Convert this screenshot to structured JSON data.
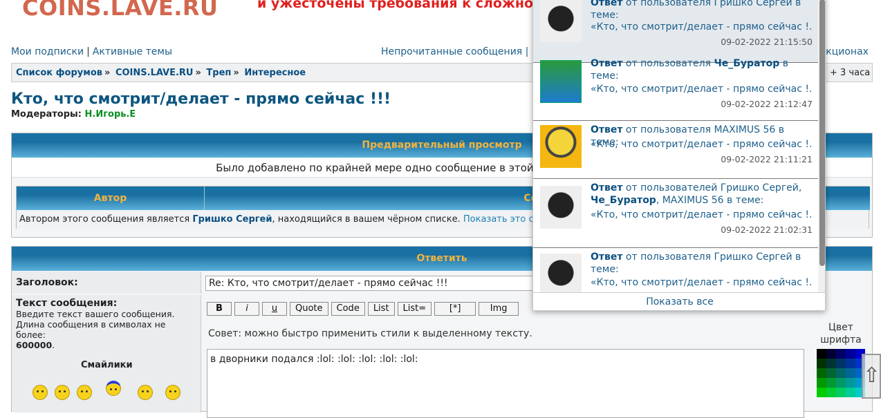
{
  "header": {
    "logo": "COINS.LAVE.RU",
    "banner": "и ужесточены требования к сложнос"
  },
  "nav": {
    "subscriptions": "Мои подписки",
    "sep": "|",
    "active_topics": "Активные темы",
    "unread": "Непрочитанные сообщения",
    "unread_sep": "| Н",
    "auctions": "укционах"
  },
  "breadcrumb": {
    "items": [
      "Список форумов",
      "COINS.LAVE.RU",
      "Треп",
      "Интересное"
    ],
    "sep": "»",
    "timezone": "+ 3 часа"
  },
  "topic": {
    "title": "Кто, что смотрит/делает - прямо сейчас !!!",
    "moderators_label": "Модераторы:",
    "moderator": "Н.Игорь.Е"
  },
  "preview": {
    "heading": "Предварительный просмотр",
    "notice": "Было добавлено по крайней мере одно сообщение в этой теме. Возможно, вы зах",
    "author_col": "Автор",
    "message_col": "Сооб",
    "blocked_prefix": "Автором этого сообщения является",
    "blocked_user": "Гришко Сергей",
    "blocked_suffix": ", находящийся в вашем чёрном списке.",
    "show_link": "Показать это сообще"
  },
  "reply": {
    "heading": "Ответить",
    "subject_label": "Заголовок:",
    "subject_value": "Re: Кто, что смотрит/делает - прямо сейчас !!!",
    "text_label": "Текст сообщения:",
    "hint1": "Введите текст вашего сообщения.",
    "hint2": "Длина сообщения в символах не более:",
    "max_len": "600000",
    "smilies_label": "Смайлики",
    "toolbar": {
      "bold": "B",
      "italic": "i",
      "underline": "u",
      "quote": "Quote",
      "code": "Code",
      "list": "List",
      "list_eq": "List=",
      "star": "[*]",
      "img": "Img"
    },
    "tip": "Совет: можно быстро применить стили к выделенному тексту.",
    "message": "в дворники подался  :lol:  :lol:  :lol:  :lol:  :lol:",
    "font_color_label": "Цвет шрифта"
  },
  "notifications": {
    "items": [
      {
        "prefix": "Ответ",
        "text": " от пользователя Гришко Сергей в теме:",
        "quote": "«Кто, что смотрит/делает - прямо сейчас !...",
        "time": "09-02-2022 21:15:50"
      },
      {
        "prefix": "Ответ",
        "text_a": " от пользователя ",
        "user": "Че_Буратор",
        "text_b": " в теме:",
        "quote": "«Кто, что смотрит/делает - прямо сейчас !...",
        "time": "09-02-2022 21:12:47"
      },
      {
        "prefix": "Ответ",
        "text": " от пользователя MAXIMUS 56 в теме:",
        "quote": "«Кто, что смотрит/делает - прямо сейчас !...",
        "time": "09-02-2022 21:11:21"
      },
      {
        "prefix": "Ответ",
        "text_a": " от пользователей Гришко Сергей,",
        "user": "Че_Буратор",
        "text_b": ", MAXIMUS 56 в теме:",
        "quote": "«Кто, что смотрит/делает - прямо сейчас !...",
        "time": "09-02-2022 21:02:31"
      },
      {
        "prefix": "Ответ",
        "text": " от пользователя Гришко Сергей в теме:",
        "quote": "«Кто, что смотрит/делает - прямо сейчас !..."
      }
    ],
    "show_all": "Показать все"
  },
  "colors": {
    "accent": "#1872a6",
    "header_text": "#f2b33d",
    "logo": "#d3674e",
    "banner": "#e0201e",
    "link": "#1e5f8a"
  }
}
